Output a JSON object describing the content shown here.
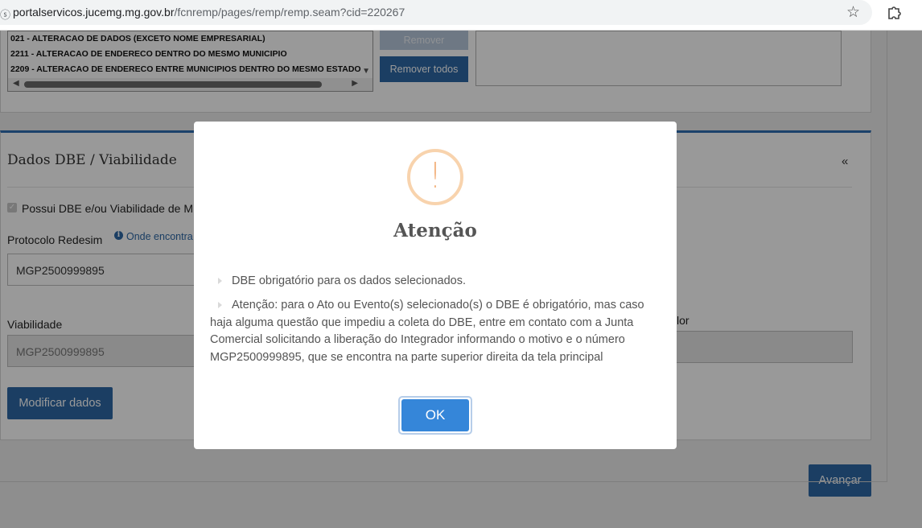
{
  "browser": {
    "url_host": "portalservicos.jucemg.mg.gov.br",
    "url_path": "/fcnremp/pages/remp/remp.seam?cid=220267"
  },
  "events_list": {
    "items": [
      "021 - ALTERACAO DE DADOS (EXCETO NOME EMPRESARIAL)",
      "2211 - ALTERACAO DE ENDERECO DENTRO DO MESMO MUNICIPIO",
      "2209 - ALTERACAO DE ENDERECO ENTRE MUNICIPIOS DENTRO DO MESMO ESTADO"
    ]
  },
  "buttons": {
    "remover": "Remover",
    "remover_todos": "Remover todos",
    "modificar": "Modificar dados",
    "avancar": "Avançar"
  },
  "dbe_section": {
    "title": "Dados DBE / Viabilidade",
    "collapse_glyph": "«",
    "checkbox_label": "Possui DBE e/ou Viabilidade de M",
    "protocolo_label": "Protocolo Redesim",
    "info_link": "Onde encontra",
    "protocolo_value": "MGP2500999895",
    "viabilidade_label": "Viabilidade",
    "viabilidade_value": "MGP2500999895",
    "right_label": "lor"
  },
  "modal": {
    "icon": "exclamation-icon",
    "icon_glyph": "!",
    "title": "Atenção",
    "message1": "DBE obrigatório para os dados selecionados.",
    "message2": "Atenção: para o Ato ou Evento(s) selecionado(s) o DBE é obrigatório, mas caso haja alguma questão que impediu a coleta do DBE, entre em contato com a Junta Comercial solicitando a liberação do Integrador informando o motivo e o número MGP2500999895, que se encontra na parte superior direita da tela principal",
    "ok_label": "OK"
  },
  "colors": {
    "primary": "#2d68a6",
    "ok_button": "#3586d9",
    "warning_ring": "#f8d3ad"
  }
}
